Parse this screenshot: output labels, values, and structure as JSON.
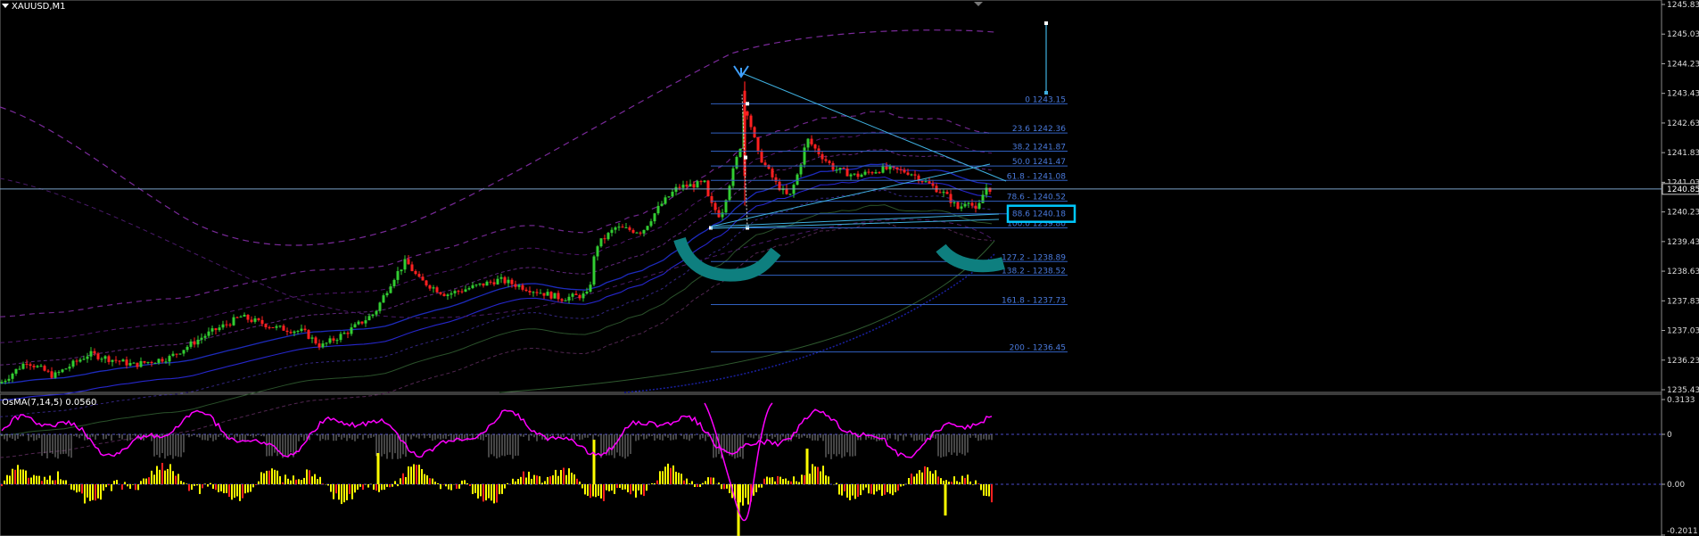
{
  "window": {
    "symbol_title": "XAUUSD,M1",
    "indicator_title": "OsMA(7,14,5) 0.0560"
  },
  "price_axis": {
    "labels": [
      "1245.83",
      "1245.03",
      "1244.23",
      "1243.43",
      "1242.63",
      "1241.83",
      "1241.03",
      "1240.23",
      "1239.43",
      "1238.63",
      "1237.83",
      "1237.03",
      "1236.23",
      "1235.43"
    ],
    "current_price": "1240.85",
    "highlight_price": "88.6 1240.18"
  },
  "osma_axis": {
    "labels": [
      "0.3133",
      "0",
      "0.00",
      "-0.2011"
    ]
  },
  "fibonacci": {
    "levels": [
      {
        "label": "0 1243.15",
        "price": 1243.15
      },
      {
        "label": "23.6 1242.36",
        "price": 1242.36
      },
      {
        "label": "38.2 1241.87",
        "price": 1241.87
      },
      {
        "label": "50.0 1241.47",
        "price": 1241.47
      },
      {
        "label": "61.8 - 1241.08",
        "price": 1241.08
      },
      {
        "label": "78.6 - 1240.52",
        "price": 1240.52
      },
      {
        "label": "88.6 1240.18",
        "price": 1240.18
      },
      {
        "label": "100.0 1239.80",
        "price": 1239.8
      },
      {
        "label": "127.2 - 1238.89",
        "price": 1238.89
      },
      {
        "label": "138.2 - 1238.52",
        "price": 1238.52
      },
      {
        "label": "161.8 - 1237.73",
        "price": 1237.73
      },
      {
        "label": "200 - 1236.45",
        "price": 1236.45
      }
    ]
  },
  "colors": {
    "background": "#000000",
    "bull": "#32cd32",
    "bear": "#ff2020",
    "fib_line": "#3060c0",
    "fib_text": "#4a7adc",
    "trendline": "#3fb0e0",
    "highlight_box": "#00c8ff",
    "osma_line": "#ff00ff",
    "osma_bar_pos": "#ffff00",
    "osma_bar_neg": "#ff2020",
    "teal_arc": "#0e7f7f"
  },
  "icons": {
    "menu": "chevron-down-icon",
    "arrow": "down-arrow-icon"
  }
}
